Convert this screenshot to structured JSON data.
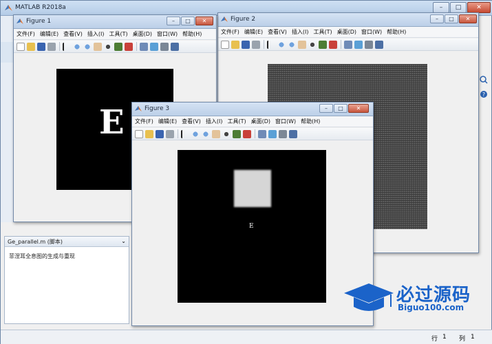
{
  "main_window": {
    "title": "MATLAB R2018a",
    "controls": {
      "minimize": "–",
      "maximize": "□",
      "close": "✕"
    }
  },
  "script_panel": {
    "filename": "Ge_parallel.m  (脚本)",
    "description": "菲涅耳全息图的生成与重现"
  },
  "status_bar": {
    "row_label": "行",
    "row_value": "1",
    "col_label": "列",
    "col_value": "1"
  },
  "figures": [
    {
      "title": "Figure 1",
      "image_letter": "E"
    },
    {
      "title": "Figure 2"
    },
    {
      "title": "Figure 3",
      "image_letter": "E"
    }
  ],
  "figure_menu": [
    "文件(F)",
    "编辑(E)",
    "查看(V)",
    "插入(I)",
    "工具(T)",
    "桌面(D)",
    "窗口(W)",
    "帮助(H)"
  ],
  "watermark": {
    "cn": "必过源码",
    "en": "Biguo100.com"
  },
  "colors": {
    "titlebar_top": "#d5e3f4",
    "titlebar_bottom": "#bcd0e8",
    "canvas_bg": "#f0f0f0",
    "image_bg": "#000000",
    "watermark_blue": "#1b63c9"
  }
}
